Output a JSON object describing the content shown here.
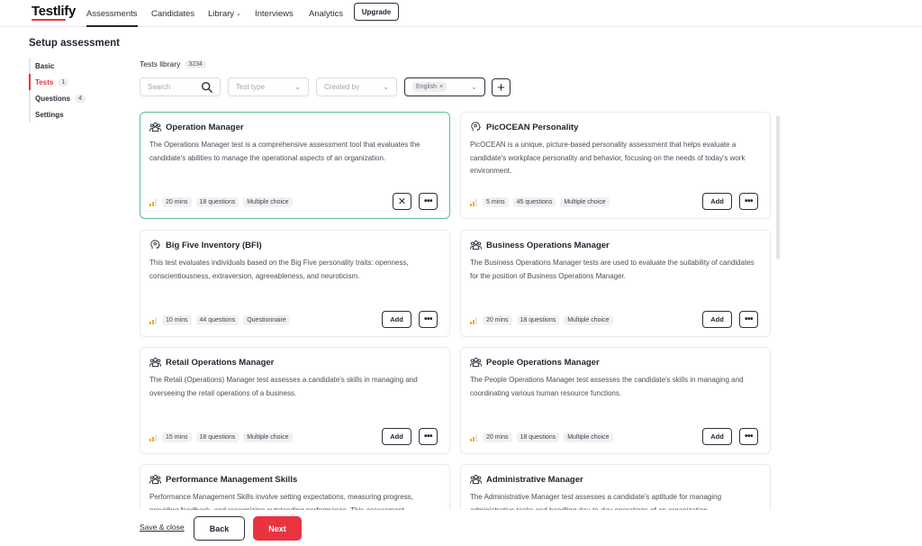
{
  "app": {
    "logo": "Testlify"
  },
  "nav": {
    "items": [
      {
        "label": "Assessments"
      },
      {
        "label": "Candidates"
      },
      {
        "label": "Library"
      },
      {
        "label": "Interviews"
      },
      {
        "label": "Analytics"
      }
    ],
    "upgrade_label": "Upgrade"
  },
  "page": {
    "title": "Setup assessment"
  },
  "steps": [
    {
      "label": "Basic",
      "count": ""
    },
    {
      "label": "Tests",
      "count": "1"
    },
    {
      "label": "Questions",
      "count": "4"
    },
    {
      "label": "Settings",
      "count": ""
    }
  ],
  "library": {
    "title": "Tests library",
    "count": "3234",
    "search_placeholder": "Search",
    "test_type_placeholder": "Test type",
    "created_by_placeholder": "Created by",
    "language_chip": "English"
  },
  "cards": [
    {
      "icon": "users-icon",
      "title": "Operation Manager",
      "desc": "The Operations Manager test is a comprehensive assessment tool that evaluates the candidate's abilities to manage the operational aspects of an organization.",
      "duration": "20 mins",
      "questions": "18 questions",
      "type": "Multiple choice",
      "added": true
    },
    {
      "icon": "head-icon",
      "title": "PicOCEAN Personality",
      "desc": "PicOCEAN is a unique, picture-based personality assessment that helps evaluate a candidate's workplace personality and behavior, focusing on the needs of today's work environment.",
      "duration": "5 mins",
      "questions": "45 questions",
      "type": "Multiple choice",
      "added": false
    },
    {
      "icon": "head-icon",
      "title": "Big Five Inventory (BFI)",
      "desc": "This test evaluates individuals based on the Big Five personality traits: openness, conscientiousness, extraversion, agreeableness, and neuroticism.",
      "duration": "10 mins",
      "questions": "44 questions",
      "type": "Questionnaire",
      "added": false
    },
    {
      "icon": "users-icon",
      "title": "Business Operations Manager",
      "desc": "The Business Operations Manager tests are used to evaluate the suitability of candidates for the position of Business Operations Manager.",
      "duration": "20 mins",
      "questions": "18 questions",
      "type": "Multiple choice",
      "added": false
    },
    {
      "icon": "users-icon",
      "title": "Retail Operations Manager",
      "desc": "The Retail (Operations) Manager test assesses a candidate's skills in managing and overseeing the retail operations of a business.",
      "duration": "15 mins",
      "questions": "18 questions",
      "type": "Multiple choice",
      "added": false
    },
    {
      "icon": "users-icon",
      "title": "People Operations Manager",
      "desc": "The People Operations Manager test assesses the candidate's skills in managing and coordinating various human resource functions.",
      "duration": "20 mins",
      "questions": "18 questions",
      "type": "Multiple choice",
      "added": false
    },
    {
      "icon": "users-icon",
      "title": "Performance Management Skills",
      "desc": "Performance Management Skills involve setting expectations, measuring progress, providing feedback, and recognizing outstanding performance. This assessment",
      "duration": "",
      "questions": "",
      "type": "",
      "added": false
    },
    {
      "icon": "users-icon",
      "title": "Administrative Manager",
      "desc": "The Administrative Manager test assesses a candidate's aptitude for managing administrative tasks and handling day-to-day operations of an organization.",
      "duration": "",
      "questions": "",
      "type": "",
      "added": false
    }
  ],
  "card_actions": {
    "add_label": "Add",
    "remove_symbol": "✕",
    "more_symbol": "•••"
  },
  "footer": {
    "save_close_label": "Save & close",
    "back_label": "Back",
    "next_label": "Next"
  },
  "colors": {
    "accent": "#e8343f",
    "selected_border": "#5cbf8c",
    "level_bars": "#f5a524"
  }
}
